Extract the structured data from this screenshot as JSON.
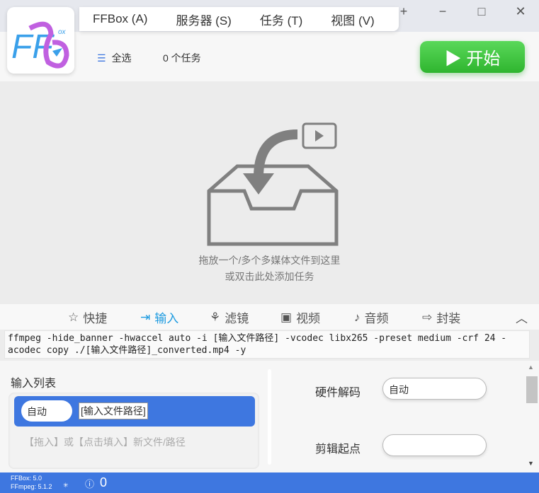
{
  "menu": [
    "FFBox (A)",
    "服务器 (S)",
    "任务 (T)",
    "视图 (V)"
  ],
  "window_controls": {
    "add": "+",
    "minimize": "−",
    "maximize": "□",
    "close": "✕"
  },
  "logo_text": "FFBox",
  "toolbar": {
    "select_all": "全选",
    "task_count": "0 个任务",
    "start": "▶ 开始"
  },
  "drop": {
    "line1": "拖放一个/多个多媒体文件到这里",
    "line2": "或双击此处添加任务"
  },
  "tabs": [
    {
      "label": "快捷"
    },
    {
      "label": "输入"
    },
    {
      "label": "滤镜"
    },
    {
      "label": "视频"
    },
    {
      "label": "音频"
    },
    {
      "label": "封装"
    }
  ],
  "active_tab": "输入",
  "command": "ffmpeg -hide_banner -hwaccel auto -i [输入文件路径] -vcodec libx265 -preset medium -crf 24 -acodec copy ./[输入文件路径]_converted.mp4 -y",
  "input": {
    "title": "输入列表",
    "item_mode": "自动",
    "item_path": "[输入文件路径]",
    "add_hint": "【拖入】或【点击填入】新文件/路径"
  },
  "settings": [
    {
      "label": "硬件解码",
      "value": "自动"
    },
    {
      "label": "剪辑起点",
      "value": ""
    }
  ],
  "status": {
    "ffbox": "FFBox: 5.0",
    "ffmpeg": "FFmpeg: 5.1.2",
    "notifications": "0"
  },
  "colors": {
    "accent": "#3e77e0",
    "start": "#3cc43c",
    "tab_active": "#1e9be0"
  }
}
